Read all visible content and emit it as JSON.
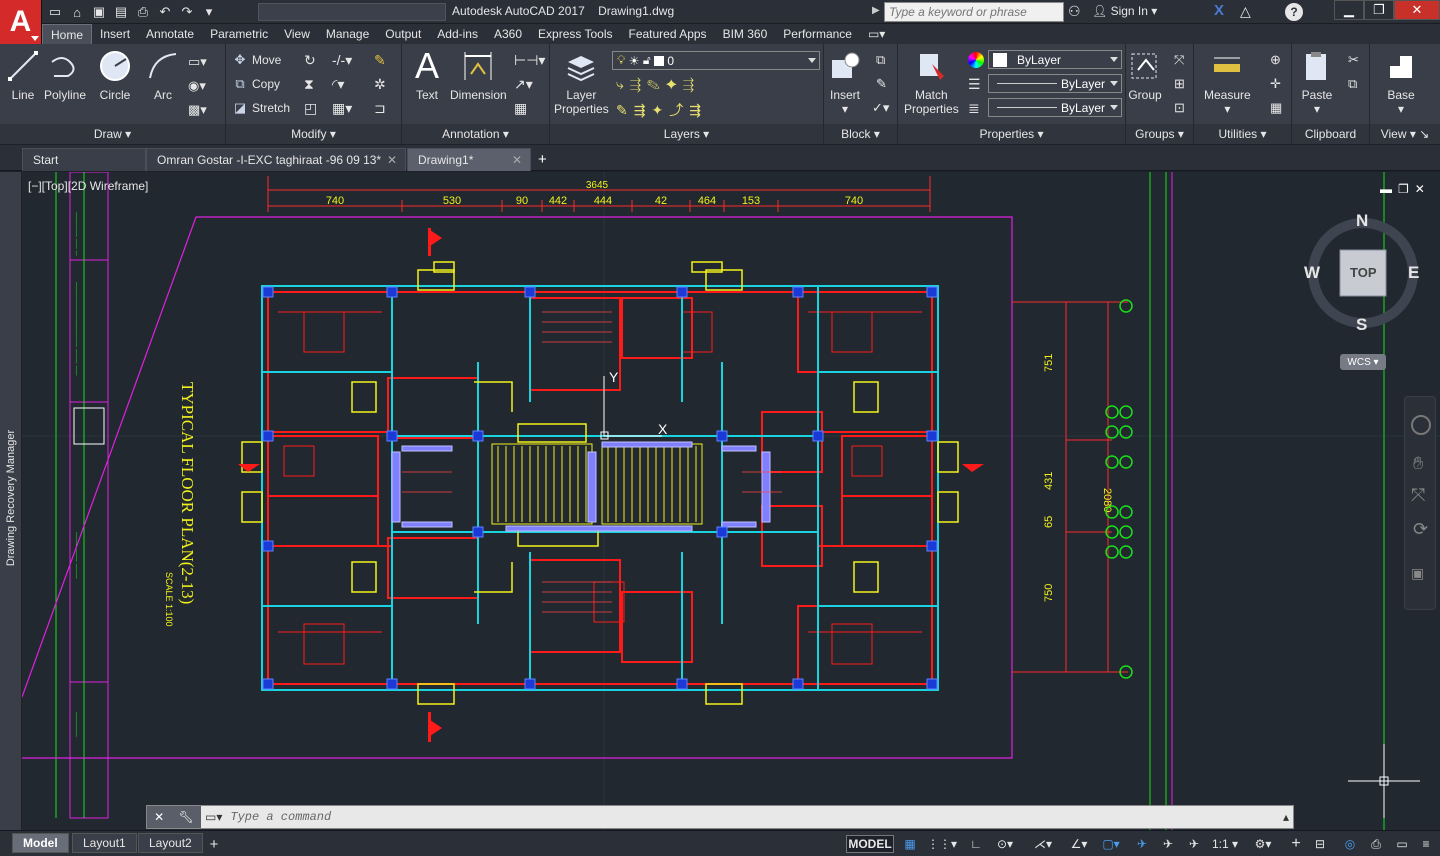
{
  "app": {
    "logo_letter": "A",
    "title": "Autodesk AutoCAD 2017    Drawing1.dwg",
    "search_placeholder": "Type a keyword or phrase",
    "sign_in": "Sign In",
    "help": "?"
  },
  "menu_tabs": [
    "Home",
    "Insert",
    "Annotate",
    "Parametric",
    "View",
    "Manage",
    "Output",
    "Add-ins",
    "A360",
    "Express Tools",
    "Featured Apps",
    "BIM 360",
    "Performance"
  ],
  "ribbon": {
    "draw": {
      "title": "Draw",
      "line": "Line",
      "polyline": "Polyline",
      "circle": "Circle",
      "arc": "Arc"
    },
    "modify": {
      "title": "Modify",
      "move": "Move",
      "copy": "Copy",
      "stretch": "Stretch"
    },
    "annotation": {
      "title": "Annotation",
      "text": "Text",
      "dimension": "Dimension"
    },
    "layers": {
      "title": "Layers",
      "layer_properties": "Layer\nProperties",
      "current_layer": "0"
    },
    "block": {
      "title": "Block",
      "insert": "Insert"
    },
    "properties": {
      "title": "Properties",
      "match": "Match\nProperties",
      "color": "ByLayer",
      "linetype": "ByLayer",
      "lineweight": "ByLayer"
    },
    "groups": {
      "title": "Groups",
      "group": "Group"
    },
    "utilities": {
      "title": "Utilities",
      "measure": "Measure"
    },
    "clipboard": {
      "title": "Clipboard",
      "paste": "Paste"
    },
    "view": {
      "title": "View",
      "base": "Base"
    }
  },
  "file_tabs": [
    {
      "label": "Start"
    },
    {
      "label": "Omran Gostar -I-EXC  taghiraat -96 09 13*"
    },
    {
      "label": "Drawing1*"
    }
  ],
  "viewport": {
    "label": "[−][Top][2D Wireframe]",
    "drawing_recovery": "Drawing Recovery Manager",
    "plan_title": "TYPICAL FLOOR PLAN(2-13)",
    "scale_text": "SCALE 1:100",
    "total_dim": "3645",
    "top_dims": [
      "740",
      "530",
      "90",
      "442",
      "444",
      "42",
      "464",
      "153",
      "740"
    ],
    "right_dims": [
      "751",
      "431",
      "65",
      "750"
    ],
    "right_total": "2080"
  },
  "viewcube": {
    "n": "N",
    "s": "S",
    "e": "E",
    "w": "W",
    "face": "TOP",
    "wcs": "WCS"
  },
  "command": {
    "placeholder": "Type a command"
  },
  "status": {
    "layout_tabs": [
      "Model",
      "Layout1",
      "Layout2"
    ],
    "model": "MODEL",
    "scale": "1:1"
  },
  "colors": {
    "accent": "#d42a2a",
    "wall": "#ff1a1a",
    "cyan": "#19d3e0",
    "yellow": "#f2f21a",
    "magenta": "#e020e0",
    "green": "#19e019"
  }
}
